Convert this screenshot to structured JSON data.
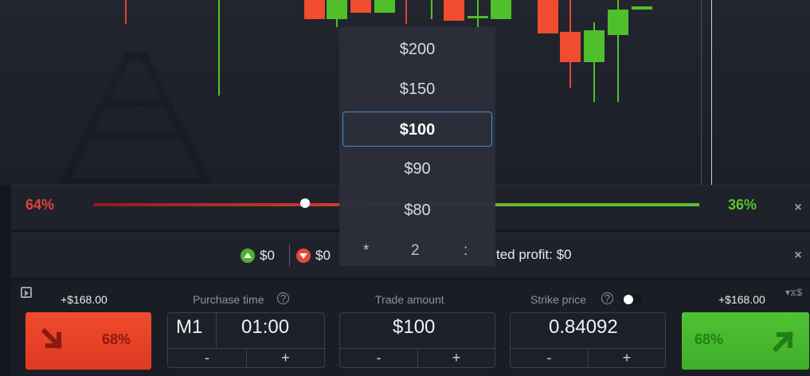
{
  "chart": {
    "candles": [
      {
        "color": "red",
        "open": 0,
        "close": 0
      },
      {
        "color": "green",
        "open": 0,
        "close": 0
      }
    ]
  },
  "sentiment": {
    "sell_percent": "64%",
    "buy_percent": "36%",
    "buy_fraction": 0.36,
    "close_label": "×"
  },
  "status": {
    "up_amount": "$0",
    "down_amount": "$0",
    "expected_profit": "ted profit: $0",
    "close_label": "×"
  },
  "dropdown": {
    "options": [
      "$200",
      "$150",
      "$100",
      "$90",
      "$80"
    ],
    "selected": "$100",
    "multiplier_symbol": "*",
    "multiplier_value": "2",
    "colon": ":"
  },
  "trade": {
    "sell_profit": "+$168.00",
    "buy_profit": "+$168.00",
    "purchase_time_label": "Purchase time",
    "purchase_time_mode": "M1",
    "purchase_time_value": "01:00",
    "trade_amount_label": "Trade amount",
    "trade_amount_value": "$100",
    "strike_price_label": "Strike price",
    "strike_price_value": "0.84092",
    "sell_percent": "68%",
    "buy_percent": "68%",
    "minus": "-",
    "plus": "+",
    "help": "?",
    "corner_symbol": "▾⧖$"
  },
  "colors": {
    "sell": "#e5413a",
    "buy": "#53c72a",
    "selected_border": "#4b8ad7"
  }
}
